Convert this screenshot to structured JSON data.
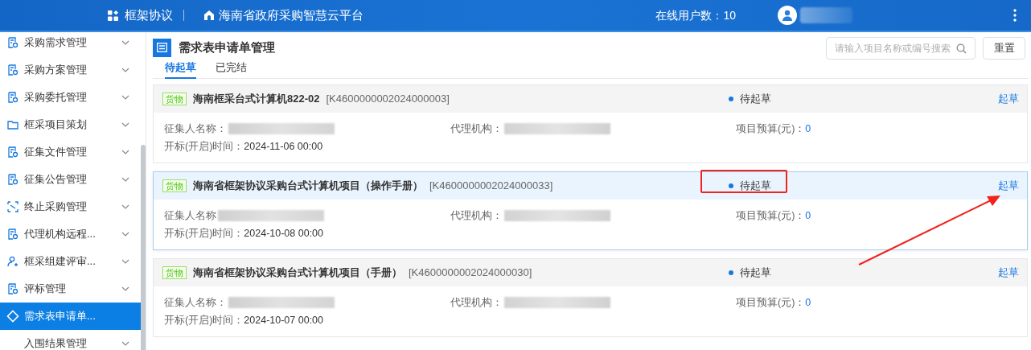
{
  "header": {
    "module": "框架协议",
    "platform": "海南省政府采购智慧云平台",
    "online_label": "在线用户数：10"
  },
  "sidebar": {
    "items": [
      {
        "label": "采购需求管理",
        "selected": false
      },
      {
        "label": "采购方案管理",
        "selected": false
      },
      {
        "label": "采购委托管理",
        "selected": false
      },
      {
        "label": "框采项目策划",
        "selected": false
      },
      {
        "label": "征集文件管理",
        "selected": false
      },
      {
        "label": "征集公告管理",
        "selected": false
      },
      {
        "label": "终止采购管理",
        "selected": false
      },
      {
        "label": "代理机构远程...",
        "selected": false
      },
      {
        "label": "框采组建评审...",
        "selected": false
      },
      {
        "label": "评标管理",
        "selected": false
      },
      {
        "label": "需求表申请单...",
        "selected": true
      },
      {
        "label": "入围结果管理",
        "selected": false
      }
    ]
  },
  "page": {
    "title": "需求表申请单管理",
    "search": {
      "placeholder": "请输入项目名称或编号搜索"
    },
    "reset_button": "重置",
    "tabs": [
      {
        "label": "待起草",
        "selected": true
      },
      {
        "label": "已完结",
        "selected": false
      }
    ]
  },
  "cards": [
    {
      "tag": "货物",
      "title": "海南框采台式计算机822-02",
      "code": "[K4600000002024000003]",
      "status": "待起草",
      "action": "起草",
      "selected": false,
      "annotated": false,
      "collector_label": "征集人名称：",
      "agency_label": "代理机构：",
      "budget_label": "项目预算(元)：",
      "budget": "0",
      "date_label": "开标(开启)时间：",
      "date": "2024-11-06 00:00"
    },
    {
      "tag": "货物",
      "title": "海南省框架协议采购台式计算机项目（操作手册）",
      "code": "[K4600000002024000033]",
      "status": "待起草",
      "action": "起草",
      "selected": true,
      "annotated": true,
      "collector_label": "征集人名称",
      "agency_label": "代理机构：",
      "budget_label": "项目预算(元)：",
      "budget": "0",
      "date_label": "开标(开启)时间：",
      "date": "2024-10-08 00:00"
    },
    {
      "tag": "货物",
      "title": "海南省框架协议采购台式计算机项目（手册）",
      "code": "[K4600000002024000030]",
      "status": "待起草",
      "action": "起草",
      "selected": false,
      "annotated": false,
      "collector_label": "征集人名称：",
      "agency_label": "代理机构：",
      "budget_label": "项目预算(元)：",
      "budget": "0",
      "date_label": "开标(开启)时间：",
      "date": "2024-10-07 00:00"
    }
  ]
}
